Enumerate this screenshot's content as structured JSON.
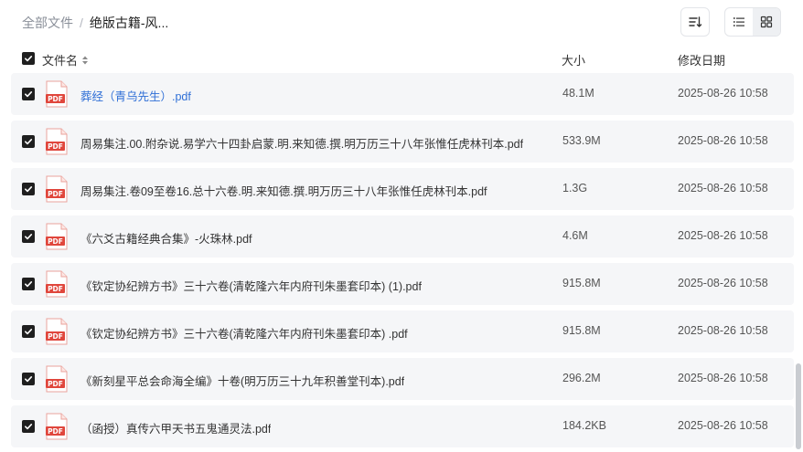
{
  "breadcrumb": {
    "root": "全部文件",
    "separator": "/",
    "current": "绝版古籍-风..."
  },
  "columns": {
    "name": "文件名",
    "size": "大小",
    "modified": "修改日期"
  },
  "files": [
    {
      "name": "葬经（青乌先生）.pdf",
      "size": "48.1M",
      "modified": "2025-08-26 10:58",
      "selected": true,
      "type": "PDF"
    },
    {
      "name": "周易集注.00.附杂说.易学六十四卦启蒙.明.来知德.撰.明万历三十八年张惟任虎林刊本.pdf",
      "size": "533.9M",
      "modified": "2025-08-26 10:58",
      "selected": true,
      "type": "PDF"
    },
    {
      "name": "周易集注.卷09至卷16.总十六卷.明.来知德.撰.明万历三十八年张惟任虎林刊本.pdf",
      "size": "1.3G",
      "modified": "2025-08-26 10:58",
      "selected": true,
      "type": "PDF"
    },
    {
      "name": "《六爻古籍经典合集》-火珠林.pdf",
      "size": "4.6M",
      "modified": "2025-08-26 10:58",
      "selected": true,
      "type": "PDF"
    },
    {
      "name": "《钦定协纪辨方书》三十六卷(清乾隆六年内府刊朱墨套印本) (1).pdf",
      "size": "915.8M",
      "modified": "2025-08-26 10:58",
      "selected": true,
      "type": "PDF"
    },
    {
      "name": "《钦定协纪辨方书》三十六卷(清乾隆六年内府刊朱墨套印本) .pdf",
      "size": "915.8M",
      "modified": "2025-08-26 10:58",
      "selected": true,
      "type": "PDF"
    },
    {
      "name": "《新刻星平总会命海全编》十卷(明万历三十九年积善堂刊本).pdf",
      "size": "296.2M",
      "modified": "2025-08-26 10:58",
      "selected": true,
      "type": "PDF"
    },
    {
      "name": "（函授）真传六甲天书五鬼通灵法.pdf",
      "size": "184.2KB",
      "modified": "2025-08-26 10:58",
      "selected": true,
      "type": "PDF"
    }
  ],
  "colors": {
    "link": "#2f6fd6",
    "row_bg": "#f5f6f8",
    "pdf_red": "#e0463c"
  }
}
